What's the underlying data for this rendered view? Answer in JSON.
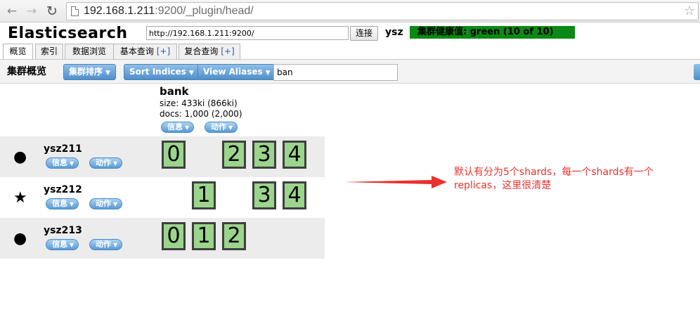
{
  "browser": {
    "nav": {
      "back_icon": "←",
      "forward_icon": "→",
      "reload_icon": "↻"
    },
    "address": {
      "host": "192.168.1.211",
      "rest": ":9200/_plugin/head/"
    },
    "bookmark_icon": "☆"
  },
  "header": {
    "title": "Elasticsearch",
    "connection_url": "http://192.168.1.211:9200/",
    "connect_label": "连接",
    "cluster_name": "ysz",
    "health_text": "集群健康值: green (10 of 10)",
    "health_color": "#0a8a14"
  },
  "tabs": [
    {
      "label": "概览",
      "plus": ""
    },
    {
      "label": "索引",
      "plus": ""
    },
    {
      "label": "数据浏览",
      "plus": ""
    },
    {
      "label": "基本查询",
      "plus": "[+]"
    },
    {
      "label": "复合查询",
      "plus": "[+]"
    }
  ],
  "toolbar": {
    "title": "集群概览",
    "sort_cluster_label": "集群排序",
    "sort_indices_label": "Sort Indices",
    "view_aliases_label": "View Aliases",
    "filter_value": "ban",
    "caret": "▼"
  },
  "index": {
    "name": "bank",
    "size": "size: 433ki (866ki)",
    "docs": "docs: 1,000 (2,000)",
    "info_label": "信息",
    "action_label": "动作"
  },
  "nodes": [
    {
      "name": "ysz211",
      "icon": "●",
      "info_label": "信息",
      "action_label": "动作",
      "shards": [
        "0",
        "",
        "2",
        "3",
        "4"
      ]
    },
    {
      "name": "ysz212",
      "icon": "★",
      "info_label": "信息",
      "action_label": "动作",
      "shards": [
        "",
        "1",
        "",
        "3",
        "4"
      ]
    },
    {
      "name": "ysz213",
      "icon": "●",
      "info_label": "信息",
      "action_label": "动作",
      "shards": [
        "0",
        "1",
        "2",
        "",
        ""
      ]
    }
  ],
  "annotation": {
    "text": "默认有分为5个shards，每一个shards有一个replicas，这里很清楚",
    "color": "#e8322e"
  }
}
